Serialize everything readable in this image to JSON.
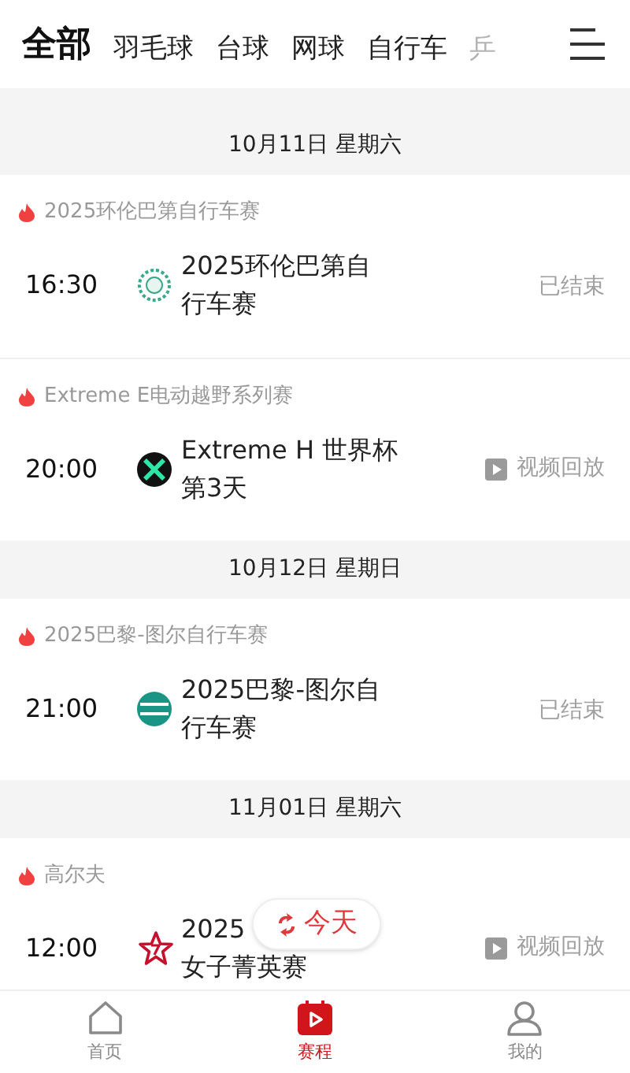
{
  "tabs": [
    {
      "label": "全部",
      "selected": true
    },
    {
      "label": "羽毛球",
      "selected": false
    },
    {
      "label": "台球",
      "selected": false
    },
    {
      "label": "网球",
      "selected": false
    },
    {
      "label": "自行车",
      "selected": false
    },
    {
      "label": "乒",
      "selected": false
    }
  ],
  "days": [
    {
      "date": "10月11日 星期六",
      "events": [
        {
          "category": "2025环伦巴第自行车赛",
          "time": "16:30",
          "title_lines": [
            "2025环伦巴第自",
            "行车赛"
          ],
          "status": {
            "kind": "ended",
            "label": "已结束"
          }
        },
        {
          "category": "Extreme E电动越野系列赛",
          "time": "20:00",
          "title_lines": [
            "Extreme H 世界杯",
            "第3天"
          ],
          "status": {
            "kind": "replay",
            "label": "视频回放"
          }
        }
      ]
    },
    {
      "date": "10月12日 星期日",
      "events": [
        {
          "category": "2025巴黎-图尔自行车赛",
          "time": "21:00",
          "title_lines": [
            "2025巴黎-图尔自",
            "行车赛"
          ],
          "status": {
            "kind": "ended",
            "label": "已结束"
          }
        }
      ]
    },
    {
      "date": "11月01日 星期六",
      "events": [
        {
          "category": "高尔夫",
          "time": "12:00",
          "title_lines": [
            "2025",
            "女子菁英赛"
          ],
          "status": {
            "kind": "replay",
            "label": "视频回放"
          }
        }
      ]
    }
  ],
  "today_button": {
    "label": "今天"
  },
  "nav": [
    {
      "label": "首页",
      "selected": false
    },
    {
      "label": "赛程",
      "selected": true
    },
    {
      "label": "我的",
      "selected": false
    }
  ]
}
